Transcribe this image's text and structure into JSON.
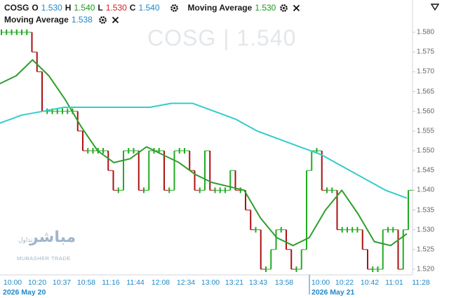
{
  "legend": {
    "symbol": "COSG",
    "open_key": "O",
    "open": "1.530",
    "high_key": "H",
    "high": "1.540",
    "low_key": "L",
    "low": "1.530",
    "close_key": "C",
    "close": "1.540",
    "ma1_label": "Moving Average",
    "ma1_value": "1.530",
    "ma2_label": "Moving Average",
    "ma2_value": "1.538"
  },
  "watermark": "COSG  |  1.540",
  "logo": {
    "arabic": "مباشر",
    "arabic_small": "تداول",
    "latin": "MUBASHER TRADE"
  },
  "colors": {
    "up": "#22aa22",
    "down": "#aa1111",
    "ma_fast": "#2e9e2e",
    "ma_slow": "#33cccc",
    "accent": "#1e88c8"
  },
  "icons": [
    "gear-icon",
    "close-icon",
    "collapse-icon"
  ],
  "chart_data": {
    "type": "line",
    "ylim": [
      1.518,
      1.581
    ],
    "y_ticks": [
      "1.520",
      "1.525",
      "1.530",
      "1.535",
      "1.540",
      "1.545",
      "1.550",
      "1.555",
      "1.560",
      "1.565",
      "1.570",
      "1.575",
      "1.580"
    ],
    "x_ticks": [
      "10:00",
      "10:20",
      "10:37",
      "10:58",
      "11:16",
      "11:44",
      "12:08",
      "12:34",
      "13:00",
      "13:21",
      "13:43",
      "13:58",
      "10:00",
      "10:22",
      "10:42",
      "11:01",
      "11:28"
    ],
    "date_labels": [
      "2026 May 20",
      "2026 May 21"
    ],
    "series": [
      {
        "kind": "ma_fast",
        "values": [
          1.567,
          1.569,
          1.573,
          1.569,
          1.563,
          1.556,
          1.55,
          1.547,
          1.548,
          1.551,
          1.549,
          1.547,
          1.544,
          1.542,
          1.541,
          1.54,
          1.533,
          1.528,
          1.526,
          1.528,
          1.535,
          1.54,
          1.534,
          1.527,
          1.526,
          1.529
        ]
      },
      {
        "kind": "ma_slow",
        "values": [
          1.557,
          1.559,
          1.56,
          1.561,
          1.561,
          1.561,
          1.561,
          1.561,
          1.562,
          1.562,
          1.56,
          1.558,
          1.555,
          1.553,
          1.551,
          1.549,
          1.546,
          1.543,
          1.54,
          1.538
        ]
      }
    ],
    "bars": [
      1.58,
      1.58,
      1.58,
      1.58,
      1.58,
      1.58,
      1.575,
      1.57,
      1.56,
      1.56,
      1.56,
      1.56,
      1.56,
      1.56,
      1.56,
      1.555,
      1.55,
      1.55,
      1.55,
      1.55,
      1.55,
      1.545,
      1.54,
      1.54,
      1.55,
      1.55,
      1.55,
      1.54,
      1.54,
      1.55,
      1.55,
      1.55,
      1.54,
      1.54,
      1.55,
      1.55,
      1.55,
      1.545,
      1.54,
      1.54,
      1.55,
      1.54,
      1.54,
      1.54,
      1.54,
      1.545,
      1.54,
      1.54,
      1.535,
      1.53,
      1.53,
      1.52,
      1.52,
      1.525,
      1.53,
      1.53,
      1.525,
      1.52,
      1.52,
      1.525,
      1.545,
      1.55,
      1.55,
      1.54,
      1.54,
      1.54,
      1.53,
      1.53,
      1.53,
      1.53,
      1.53,
      1.525,
      1.52,
      1.52,
      1.52,
      1.53,
      1.53,
      1.53,
      1.52,
      1.53,
      1.54
    ]
  }
}
